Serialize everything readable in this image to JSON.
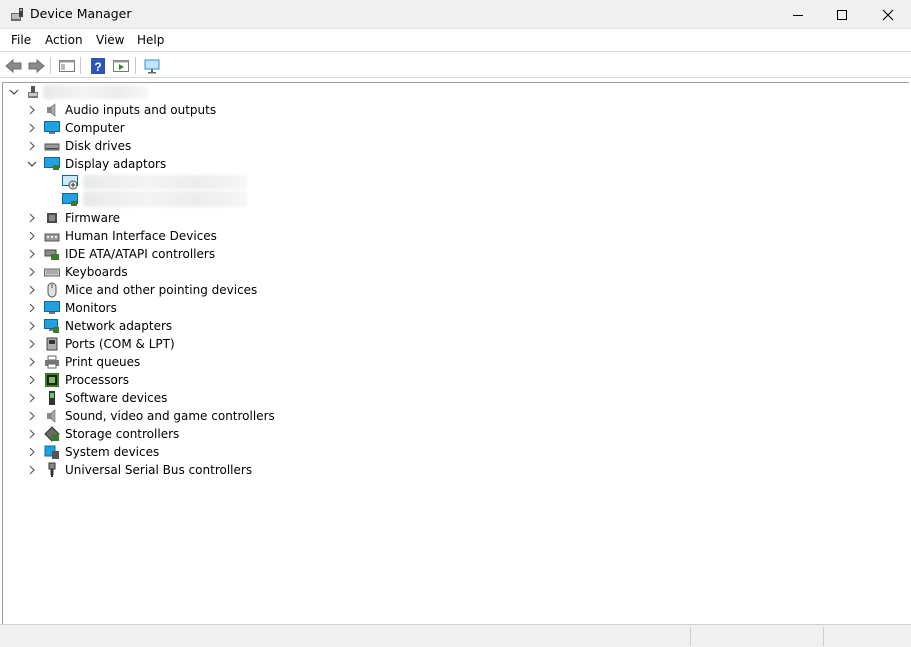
{
  "window": {
    "title": "Device Manager",
    "icon": "device-manager-icon"
  },
  "menu": {
    "file": "File",
    "action": "Action",
    "view": "View",
    "help": "Help"
  },
  "toolbar": {
    "buttons": [
      "back-icon",
      "forward-icon",
      "properties-icon",
      "help-icon",
      "show-hide-console-tree-icon",
      "scan-hardware-icon"
    ]
  },
  "tree": {
    "root_label": "",
    "categories": [
      {
        "label": "Audio inputs and outputs",
        "icon": "speaker-icon",
        "expanded": false
      },
      {
        "label": "Computer",
        "icon": "monitor-icon",
        "expanded": false
      },
      {
        "label": "Disk drives",
        "icon": "disk-drive-icon",
        "expanded": false
      },
      {
        "label": "Display adaptors",
        "icon": "display-adapter-icon",
        "expanded": true
      },
      {
        "label": "Firmware",
        "icon": "chip-icon",
        "expanded": false
      },
      {
        "label": "Human Interface Devices",
        "icon": "hid-icon",
        "expanded": false
      },
      {
        "label": "IDE ATA/ATAPI controllers",
        "icon": "ide-controller-icon",
        "expanded": false
      },
      {
        "label": "Keyboards",
        "icon": "keyboard-icon",
        "expanded": false
      },
      {
        "label": "Mice and other pointing devices",
        "icon": "mouse-icon",
        "expanded": false
      },
      {
        "label": "Monitors",
        "icon": "monitor-icon",
        "expanded": false
      },
      {
        "label": "Network adapters",
        "icon": "network-adapter-icon",
        "expanded": false
      },
      {
        "label": "Ports (COM & LPT)",
        "icon": "port-icon",
        "expanded": false
      },
      {
        "label": "Print queues",
        "icon": "printer-icon",
        "expanded": false
      },
      {
        "label": "Processors",
        "icon": "processor-icon",
        "expanded": false
      },
      {
        "label": "Software devices",
        "icon": "software-device-icon",
        "expanded": false
      },
      {
        "label": "Sound, video and game controllers",
        "icon": "speaker-icon",
        "expanded": false
      },
      {
        "label": "Storage controllers",
        "icon": "storage-controller-icon",
        "expanded": false
      },
      {
        "label": "System devices",
        "icon": "system-device-icon",
        "expanded": false
      },
      {
        "label": "Universal Serial Bus controllers",
        "icon": "usb-icon",
        "expanded": false
      }
    ],
    "display_children": [
      {
        "label": "",
        "icon": "display-adapter-warning-icon"
      },
      {
        "label": "",
        "icon": "display-adapter-icon"
      }
    ]
  },
  "colors": {
    "titlebar_bg": "#f0f0f0",
    "accent_blue": "#1e8fd6",
    "chip_green": "#3c7a2c"
  }
}
